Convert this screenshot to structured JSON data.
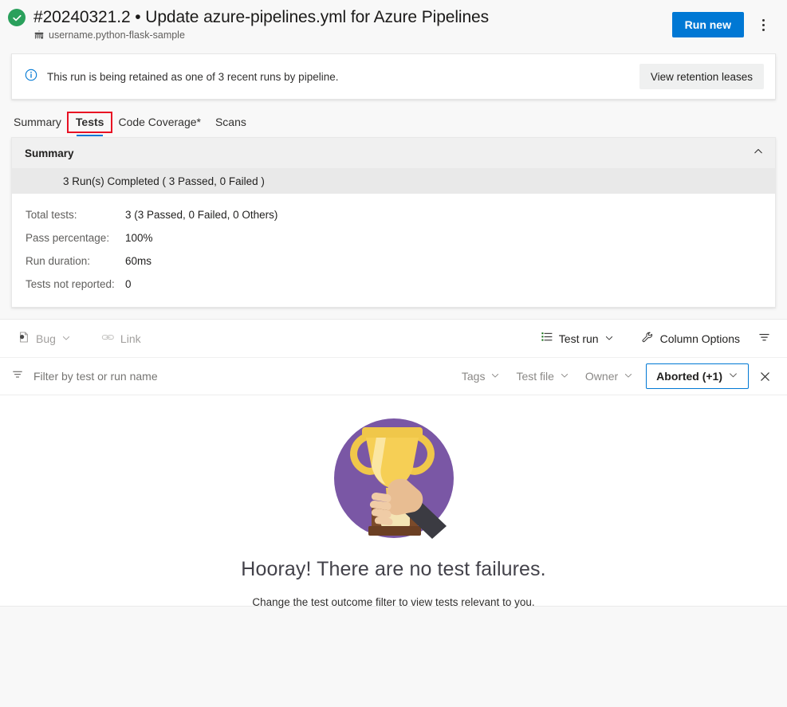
{
  "header": {
    "status_icon": "success-check-icon",
    "run_title": "#20240321.2 • Update azure-pipelines.yml for Azure Pipelines",
    "repo_icon": "repository-icon",
    "repo_name": "username.python-flask-sample",
    "run_new_label": "Run new",
    "more_actions_icon": "more-actions-icon",
    "accent_color": "#0078d4",
    "success_color": "#2aa05c"
  },
  "banner": {
    "icon": "info-icon",
    "message": "This run is being retained as one of 3 recent runs by pipeline.",
    "action_label": "View retention leases"
  },
  "tabs": [
    {
      "label": "Summary",
      "selected": false,
      "highlighted": false
    },
    {
      "label": "Tests",
      "selected": true,
      "highlighted": true
    },
    {
      "label": "Code Coverage*",
      "selected": false,
      "highlighted": false
    },
    {
      "label": "Scans",
      "selected": false,
      "highlighted": false
    }
  ],
  "highlight_color": "#e81123",
  "summary": {
    "title": "Summary",
    "collapse_icon": "chevron-up-icon",
    "run_line": "3 Run(s) Completed ( 3 Passed, 0 Failed )",
    "stats": [
      {
        "label": "Total tests:",
        "value": "3 (3 Passed, 0 Failed, 0 Others)"
      },
      {
        "label": "Pass percentage:",
        "value": "100%"
      },
      {
        "label": "Run duration:",
        "value": "60ms"
      },
      {
        "label": "Tests not reported:",
        "value": "0"
      }
    ]
  },
  "command_bar": {
    "bug": {
      "icon": "bug-icon",
      "label": "Bug",
      "caret": "chevron-down-icon",
      "disabled": true
    },
    "link": {
      "icon": "link-icon",
      "label": "Link",
      "disabled": true
    },
    "test_run": {
      "icon": "list-icon",
      "label": "Test run",
      "caret": "chevron-down-icon"
    },
    "column_options": {
      "icon": "wrench-icon",
      "label": "Column Options"
    },
    "filter_toggle": {
      "icon": "filter-icon"
    }
  },
  "filter_bar": {
    "filter_icon": "filter-icon",
    "search_placeholder": "Filter by test or run name",
    "search_value": "",
    "dropdowns": [
      {
        "label": "Tags",
        "caret": "chevron-down-icon",
        "active": false
      },
      {
        "label": "Test file",
        "caret": "chevron-down-icon",
        "active": false
      },
      {
        "label": "Owner",
        "caret": "chevron-down-icon",
        "active": false
      },
      {
        "label": "Aborted (+1)",
        "caret": "chevron-down-icon",
        "active": true
      }
    ],
    "clear_icon": "close-icon"
  },
  "empty_state": {
    "illustration": "trophy-in-hand-illustration",
    "title": "Hooray! There are no test failures.",
    "subtitle": "Change the test outcome filter to view tests relevant to you."
  }
}
